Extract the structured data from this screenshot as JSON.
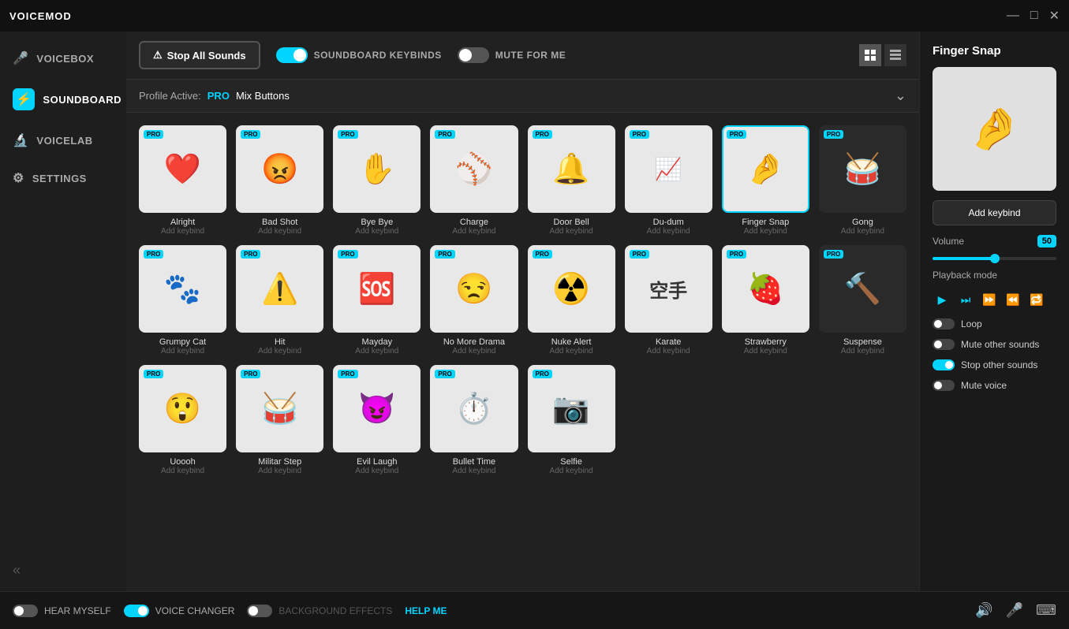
{
  "app": {
    "title": "VOICEMOD"
  },
  "titlebar": {
    "minimize": "—",
    "maximize": "□",
    "close": "✕"
  },
  "sidebar": {
    "items": [
      {
        "id": "voicebox",
        "label": "VOICEBOX",
        "icon": "🎤"
      },
      {
        "id": "soundboard",
        "label": "SOUNDBOARD",
        "icon": "⚡",
        "active": true
      },
      {
        "id": "voicelab",
        "label": "VOICELAB",
        "icon": "🔬"
      },
      {
        "id": "settings",
        "label": "SETTINGS",
        "icon": "⚙"
      }
    ],
    "collapse_icon": "«"
  },
  "toolbar": {
    "stop_all_label": "Stop All Sounds",
    "keybinds_label": "SOUNDBOARD KEYBINDS",
    "mute_label": "MUTE FOR ME",
    "keybinds_on": true,
    "mute_on": false
  },
  "profile": {
    "prefix": "Profile Active:",
    "tier": "PRO",
    "name": "Mix Buttons"
  },
  "sounds": [
    {
      "name": "Alright",
      "keybind": "Add keybind",
      "emoji": "❤️",
      "bg": "light",
      "active": false
    },
    {
      "name": "Bad Shot",
      "keybind": "Add keybind",
      "emoji": "😡",
      "bg": "light",
      "active": false
    },
    {
      "name": "Bye Bye",
      "keybind": "Add keybind",
      "emoji": "✋",
      "bg": "light",
      "active": false
    },
    {
      "name": "Charge",
      "keybind": "Add keybind",
      "emoji": "⚾",
      "bg": "light",
      "active": false
    },
    {
      "name": "Door Bell",
      "keybind": "Add keybind",
      "emoji": "🔔",
      "bg": "light",
      "active": false
    },
    {
      "name": "Du-dum",
      "keybind": "Add keybind",
      "emoji": "📈",
      "bg": "light",
      "active": false
    },
    {
      "name": "Finger Snap",
      "keybind": "Add keybind",
      "emoji": "🤌",
      "bg": "light",
      "active": true
    },
    {
      "name": "Gong",
      "keybind": "Add keybind",
      "emoji": "🥁",
      "bg": "dark",
      "active": false
    },
    {
      "name": "Grumpy Cat",
      "keybind": "Add keybind",
      "emoji": "🐾",
      "bg": "light",
      "active": false
    },
    {
      "name": "Hit",
      "keybind": "Add keybind",
      "emoji": "⚠️",
      "bg": "light",
      "active": false
    },
    {
      "name": "Mayday",
      "keybind": "Add keybind",
      "emoji": "🆘",
      "bg": "light",
      "active": false
    },
    {
      "name": "No More Drama",
      "keybind": "Add keybind",
      "emoji": "😒",
      "bg": "light",
      "active": false
    },
    {
      "name": "Nuke Alert",
      "keybind": "Add keybind",
      "emoji": "☢️",
      "bg": "light",
      "active": false
    },
    {
      "name": "Karate",
      "keybind": "Add keybind",
      "emoji": "空手",
      "bg": "light",
      "active": false
    },
    {
      "name": "Strawberry",
      "keybind": "Add keybind",
      "emoji": "🍓",
      "bg": "light",
      "active": false
    },
    {
      "name": "Suspense",
      "keybind": "Add keybind",
      "emoji": "🔨",
      "bg": "dark",
      "active": false
    },
    {
      "name": "Uoooh",
      "keybind": "Add keybind",
      "emoji": "😲",
      "bg": "light",
      "active": false
    },
    {
      "name": "Militar Step",
      "keybind": "Add keybind",
      "emoji": "🥁",
      "bg": "light",
      "active": false
    },
    {
      "name": "Evil Laugh",
      "keybind": "Add keybind",
      "emoji": "😈",
      "bg": "light",
      "active": false
    },
    {
      "name": "Bullet Time",
      "keybind": "Add keybind",
      "emoji": "⏱️",
      "bg": "light",
      "active": false
    },
    {
      "name": "Selfie",
      "keybind": "Add keybind",
      "emoji": "📷",
      "bg": "light",
      "active": false
    }
  ],
  "right_panel": {
    "title": "Finger Snap",
    "preview_emoji": "🤌",
    "add_keybind": "Add keybind",
    "volume_label": "Volume",
    "volume_value": "50",
    "playback_mode_label": "Playback mode",
    "options": [
      {
        "label": "Loop",
        "on": false
      },
      {
        "label": "Mute other sounds",
        "on": false
      },
      {
        "label": "Stop other sounds",
        "on": true
      },
      {
        "label": "Mute voice",
        "on": false
      }
    ]
  },
  "bottom_bar": {
    "hear_myself": "HEAR MYSELF",
    "voice_changer": "VOICE CHANGER",
    "bg_effects": "BACKGROUND EFFECTS",
    "help_me": "HELP ME",
    "hear_on": false,
    "voice_on": true,
    "bg_on": false
  }
}
